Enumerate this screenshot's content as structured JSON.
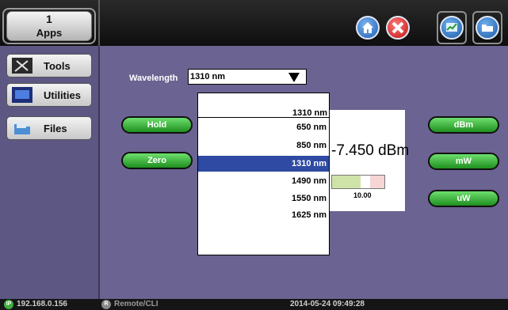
{
  "topbar": {
    "apps_count": "1",
    "apps_label": "Apps",
    "icons": [
      "home-icon",
      "close-icon",
      "chart-icon",
      "folder-icon"
    ]
  },
  "sidebar": {
    "items": [
      {
        "label": "Tools",
        "icon": "tools-icon"
      },
      {
        "label": "Utilities",
        "icon": "monitor-icon"
      },
      {
        "label": "Files",
        "icon": "files-icon"
      }
    ]
  },
  "main": {
    "wavelength_label": "Wavelength",
    "wavelength_value": "1310 nm",
    "buttons": {
      "hold": "Hold",
      "zero": "Zero",
      "dbm": "dBm",
      "mw": "mW",
      "uw": "uW"
    },
    "reading": "-7.450 dBm",
    "bar_mark": "10.00",
    "dropdown": {
      "header": "1310 nm",
      "options": [
        "650 nm",
        "850 nm",
        "1310 nm",
        "1490 nm",
        "1550 nm",
        "1625 nm"
      ],
      "selected": "1310 nm"
    }
  },
  "status": {
    "ip": "192.168.0.156",
    "remote": "Remote/CLI",
    "datetime": "2014-05-24 09:49:28",
    "ip_badge": "IP",
    "remote_badge": "R"
  },
  "colors": {
    "background": "#6b6391",
    "button_green": "#2fb52f",
    "selection_blue": "#2f4aa3"
  }
}
